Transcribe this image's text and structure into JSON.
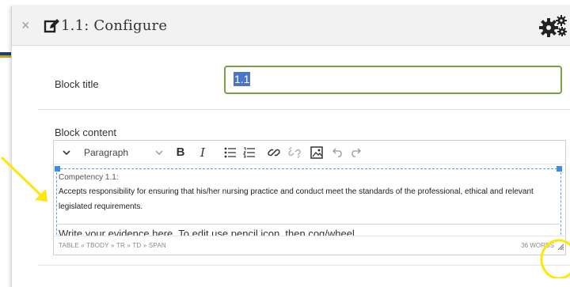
{
  "dialog": {
    "close_glyph": "×",
    "title": "1.1: Configure"
  },
  "icons": {
    "close": "close-icon",
    "edit": "edit-icon",
    "settings": "cogs-icon"
  },
  "form": {
    "block_title_label": "Block title",
    "block_title_value": "1.1",
    "block_content_label": "Block content"
  },
  "toolbar": {
    "paragraph_label": "Paragraph",
    "bold_label": "B",
    "italic_label": "I"
  },
  "content": {
    "competency_title": "Competency 1.1:",
    "competency_text": "Accepts responsibility for ensuring that his/her nursing practice and conduct meet the standards of the professional, ethical and relevant legislated requirements.",
    "evidence_prompt": "Write your evidence here. To edit use pencil icon, then cog/wheel."
  },
  "statusbar": {
    "path": "TABLE » TBODY » TR » TD » SPAN",
    "word_count": "36 WORDS"
  },
  "colors": {
    "input_border": "#7aa144",
    "selection": "#4a74c7",
    "handles": "#3b8fe0",
    "annotation": "#ffe60a"
  }
}
